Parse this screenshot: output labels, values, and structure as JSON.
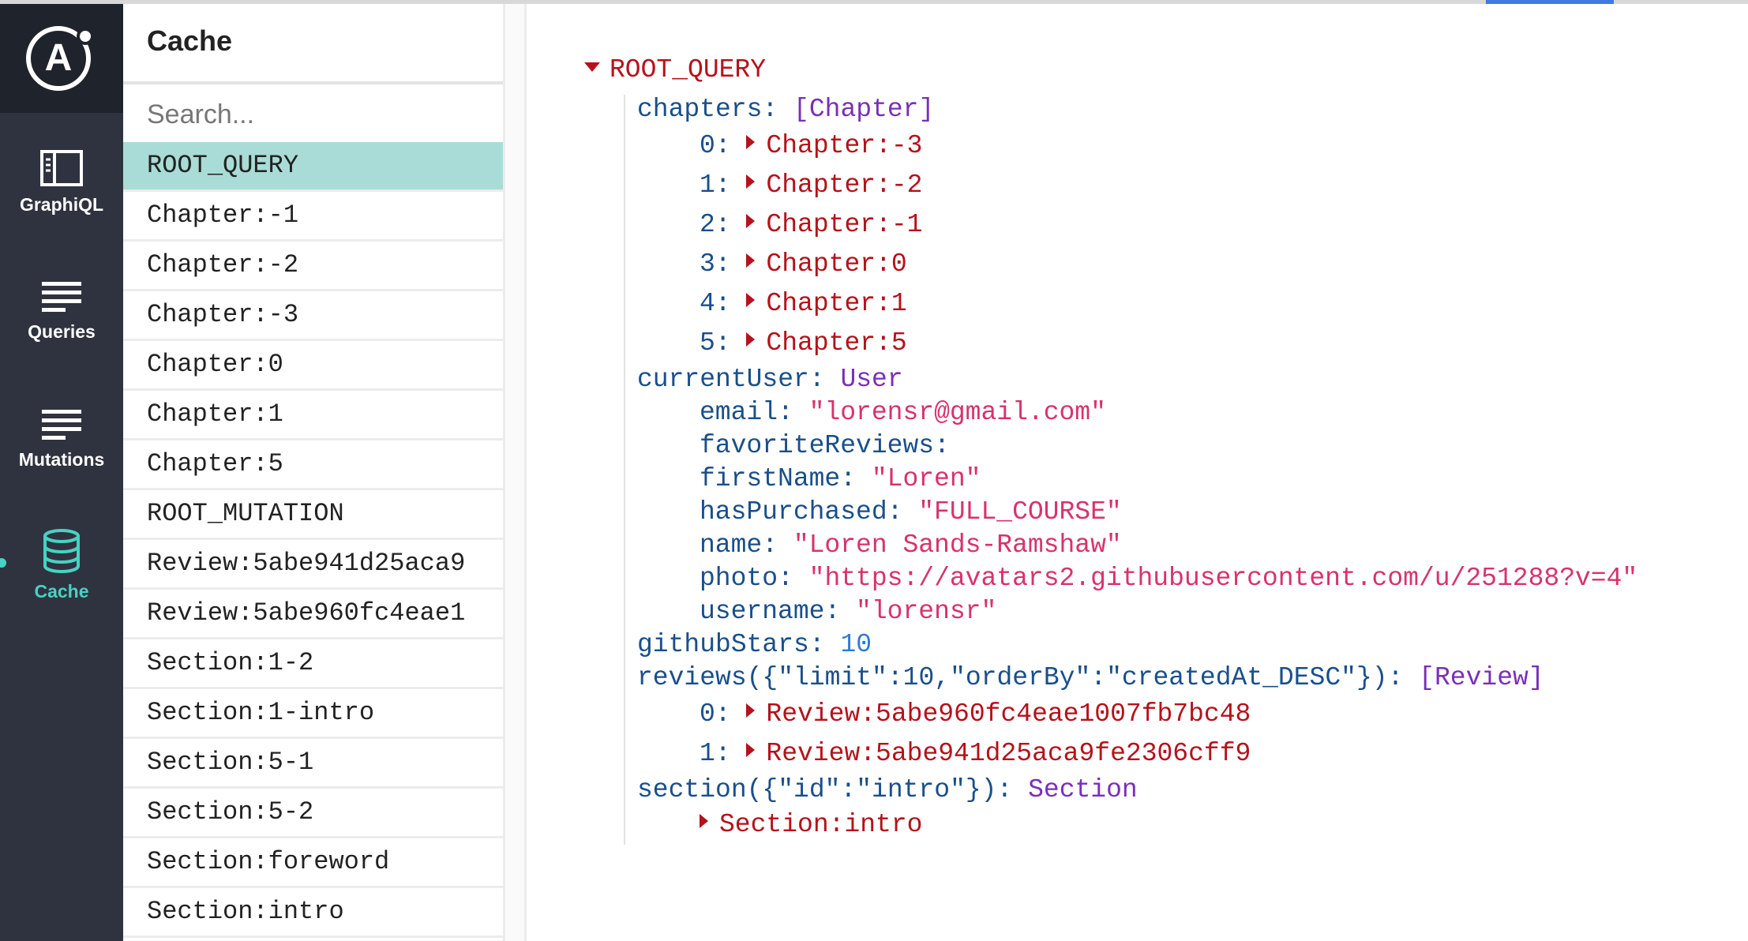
{
  "rail": {
    "logo_letter": "A",
    "nav": [
      {
        "label": "GraphiQL",
        "icon": "graphiql-panel-icon"
      },
      {
        "label": "Queries",
        "icon": "lines-icon"
      },
      {
        "label": "Mutations",
        "icon": "lines-icon"
      },
      {
        "label": "Cache",
        "icon": "database-icon",
        "active": true
      }
    ],
    "active_color": "#47d3c3"
  },
  "panel": {
    "title": "Cache",
    "search_placeholder": "Search...",
    "items": [
      "ROOT_QUERY",
      "Chapter:-1",
      "Chapter:-2",
      "Chapter:-3",
      "Chapter:0",
      "Chapter:1",
      "Chapter:5",
      "ROOT_MUTATION",
      "Review:5abe941d25aca9",
      "Review:5abe960fc4eae1",
      "Section:1-2",
      "Section:1-intro",
      "Section:5-1",
      "Section:5-2",
      "Section:foreword",
      "Section:intro"
    ],
    "selected_index": 0,
    "selected_color": "#a9dcd6"
  },
  "tree": {
    "root": "ROOT_QUERY",
    "chapters_key": "chapters",
    "chapters_type": "[Chapter]",
    "chapters": [
      {
        "idx": "0:",
        "ref": "Chapter:-3"
      },
      {
        "idx": "1:",
        "ref": "Chapter:-2"
      },
      {
        "idx": "2:",
        "ref": "Chapter:-1"
      },
      {
        "idx": "3:",
        "ref": "Chapter:0"
      },
      {
        "idx": "4:",
        "ref": "Chapter:1"
      },
      {
        "idx": "5:",
        "ref": "Chapter:5"
      }
    ],
    "currentUser_key": "currentUser",
    "currentUser_type": "User",
    "user_fields": [
      {
        "key": "email",
        "value": "\"lorensr@gmail.com\""
      },
      {
        "key": "favoriteReviews",
        "value": ""
      },
      {
        "key": "firstName",
        "value": "\"Loren\""
      },
      {
        "key": "hasPurchased",
        "value": "\"FULL_COURSE\""
      },
      {
        "key": "name",
        "value": "\"Loren Sands-Ramshaw\""
      },
      {
        "key": "photo",
        "value": "\"https://avatars2.githubusercontent.com/u/251288?v=4\""
      },
      {
        "key": "username",
        "value": "\"lorensr\""
      }
    ],
    "githubStars_key": "githubStars",
    "githubStars_value": "10",
    "reviews_key": "reviews({\"limit\":10,\"orderBy\":\"createdAt_DESC\"})",
    "reviews_type": "[Review]",
    "reviews": [
      {
        "idx": "0:",
        "ref": "Review:5abe960fc4eae1007fb7bc48"
      },
      {
        "idx": "1:",
        "ref": "Review:5abe941d25aca9fe2306cff9"
      }
    ],
    "section_key": "section({\"id\":\"intro\"})",
    "section_type": "Section",
    "section_ref": "Section:intro"
  }
}
